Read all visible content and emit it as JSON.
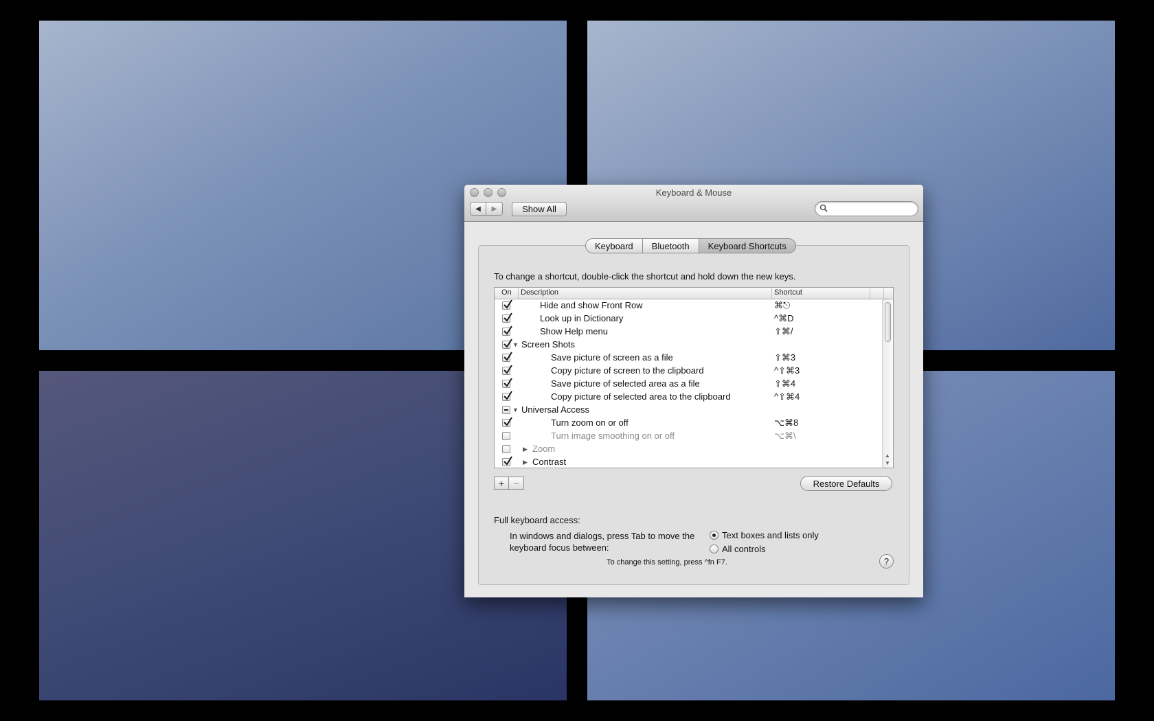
{
  "window": {
    "title": "Keyboard & Mouse"
  },
  "toolbar": {
    "back_icon": "◀",
    "forward_icon": "▶",
    "show_all_label": "Show All",
    "search_value": ""
  },
  "tabs": [
    {
      "label": "Keyboard",
      "active": false
    },
    {
      "label": "Bluetooth",
      "active": false
    },
    {
      "label": "Keyboard Shortcuts",
      "active": true
    }
  ],
  "instructions": "To change a shortcut, double-click the shortcut and hold down the new keys.",
  "table": {
    "headers": {
      "on": "On",
      "description": "Description",
      "shortcut": "Shortcut"
    },
    "rows": [
      {
        "state": "checked",
        "indent": 1,
        "expander": "",
        "description": "Hide and show Front Row",
        "shortcut": "⌘⎋",
        "disabled": false
      },
      {
        "state": "checked",
        "indent": 1,
        "expander": "",
        "description": "Look up in Dictionary",
        "shortcut": "^⌘D",
        "disabled": false
      },
      {
        "state": "checked",
        "indent": 1,
        "expander": "",
        "description": "Show Help menu",
        "shortcut": "⇧⌘/",
        "disabled": false
      },
      {
        "state": "checked",
        "indent": 0,
        "expander": "▼",
        "description": "Screen Shots",
        "shortcut": "",
        "disabled": false
      },
      {
        "state": "checked",
        "indent": 2,
        "expander": "",
        "description": "Save picture of screen as a file",
        "shortcut": "⇧⌘3",
        "disabled": false
      },
      {
        "state": "checked",
        "indent": 2,
        "expander": "",
        "description": "Copy picture of screen to the clipboard",
        "shortcut": "^⇧⌘3",
        "disabled": false
      },
      {
        "state": "checked",
        "indent": 2,
        "expander": "",
        "description": "Save picture of selected area as a file",
        "shortcut": "⇧⌘4",
        "disabled": false
      },
      {
        "state": "checked",
        "indent": 2,
        "expander": "",
        "description": "Copy picture of selected area to the clipboard",
        "shortcut": "^⇧⌘4",
        "disabled": false
      },
      {
        "state": "mixed",
        "indent": 0,
        "expander": "▼",
        "description": "Universal Access",
        "shortcut": "",
        "disabled": false
      },
      {
        "state": "checked",
        "indent": 2,
        "expander": "",
        "description": "Turn zoom on or off",
        "shortcut": "⌥⌘8",
        "disabled": false
      },
      {
        "state": "unchecked",
        "indent": 2,
        "expander": "",
        "description": "Turn image smoothing on or off",
        "shortcut": "⌥⌘\\",
        "disabled": true
      },
      {
        "state": "unchecked",
        "indent": 1,
        "expander": "▶",
        "description": "Zoom",
        "shortcut": "",
        "disabled": true
      },
      {
        "state": "checked",
        "indent": 1,
        "expander": "▶",
        "description": "Contrast",
        "shortcut": "",
        "disabled": false
      }
    ]
  },
  "buttons": {
    "add": "+",
    "remove": "−",
    "restore_defaults": "Restore Defaults"
  },
  "full_keyboard_access": {
    "title": "Full keyboard access:",
    "description": "In windows and dialogs, press Tab to move the keyboard focus between:",
    "options": [
      {
        "label": "Text boxes and lists only",
        "selected": true
      },
      {
        "label": "All controls",
        "selected": false
      }
    ],
    "hint": "To change this setting, press ^fn F7."
  },
  "help": {
    "label": "?"
  }
}
